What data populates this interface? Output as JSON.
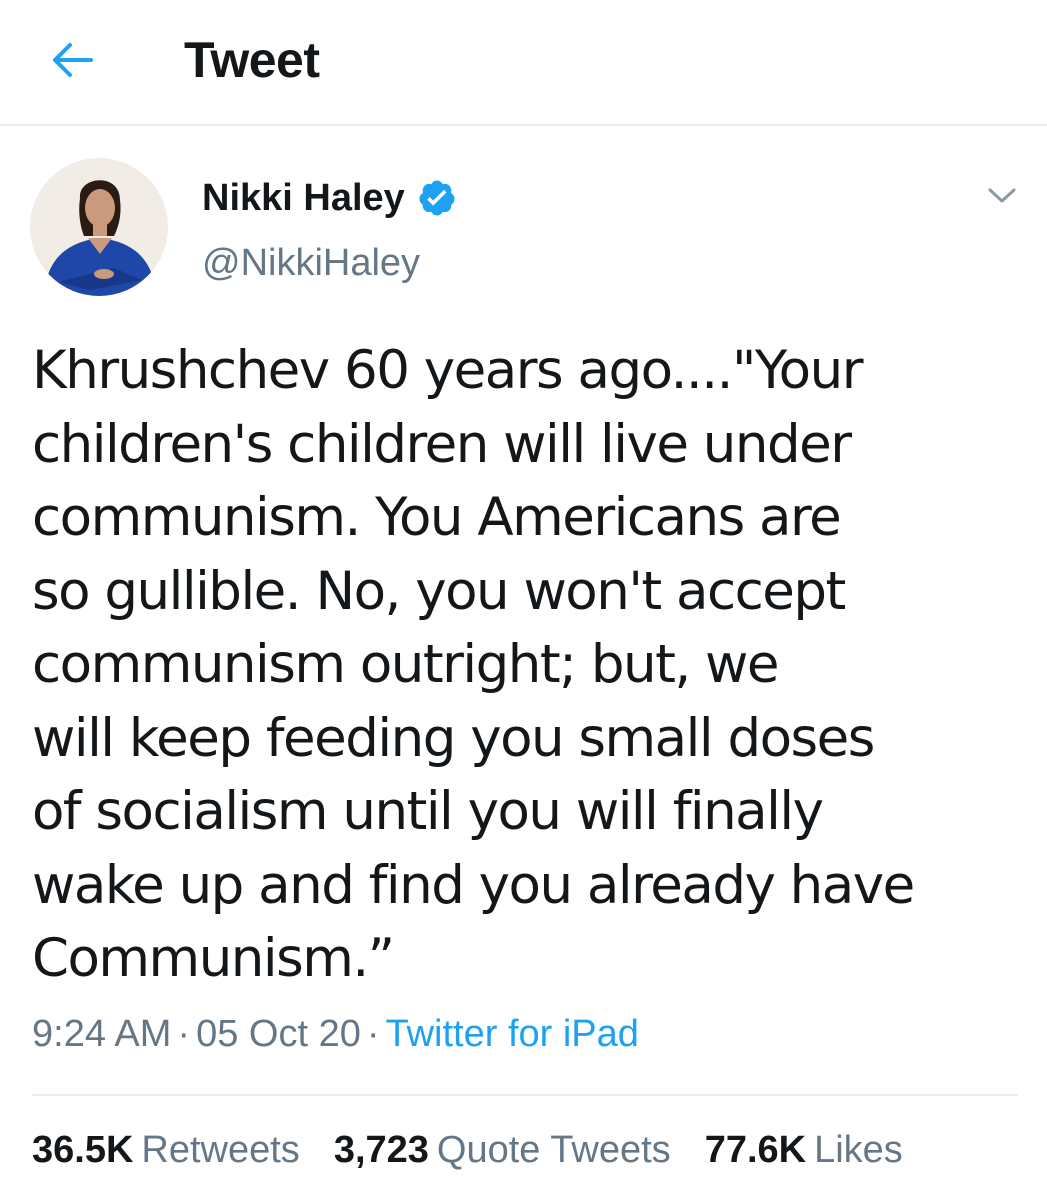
{
  "header": {
    "back_icon": "arrow-left-icon",
    "title": "Tweet"
  },
  "colors": {
    "accent": "#1da1f2",
    "secondary_text": "#657786",
    "divider": "#e6ecf0"
  },
  "tweet": {
    "author": {
      "display_name": "Nikki Haley",
      "handle": "@NikkiHaley",
      "verified_icon": "verified-badge-icon",
      "avatar_icon": "avatar-photo"
    },
    "menu_icon": "chevron-down-icon",
    "text": "Khrushchev 60 years ago....\"Your\nchildren's children will live under\ncommunism. You Americans are\nso gullible. No, you won't accept\ncommunism outright; but, we\nwill keep feeding you small doses\nof socialism until you will finally\nwake up and find you already have\nCommunism.”",
    "time": "9:24 AM",
    "separator": "·",
    "date": "05 Oct 20",
    "source": "Twitter for iPad"
  },
  "stats": {
    "retweets": {
      "count": "36.5K",
      "label": "Retweets"
    },
    "quote_tweets": {
      "count": "3,723",
      "label": "Quote Tweets"
    },
    "likes": {
      "count": "77.6K",
      "label": "Likes"
    }
  }
}
